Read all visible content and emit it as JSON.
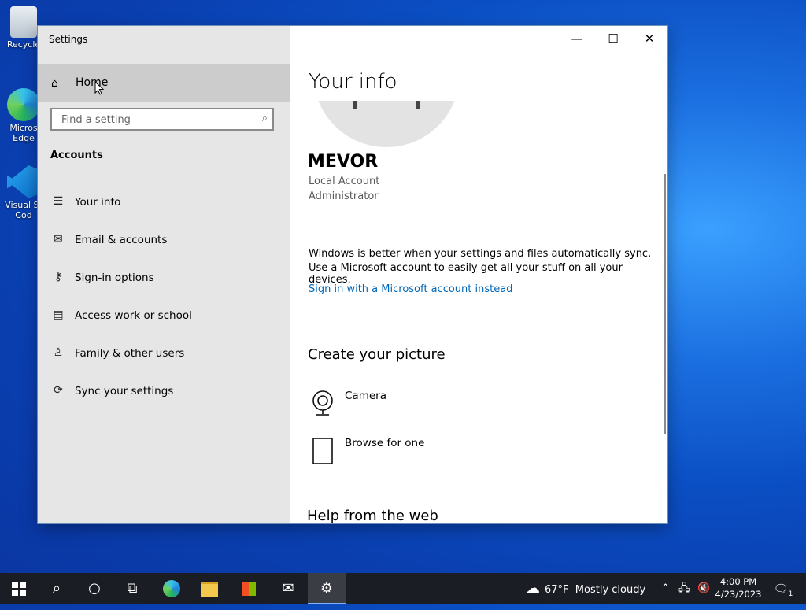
{
  "desktop": {
    "icons": [
      {
        "label": "Recycle"
      },
      {
        "label": "Micros Edge"
      },
      {
        "label": "Visual St Cod"
      }
    ]
  },
  "window": {
    "title": "Settings",
    "controls": {
      "minimize": "—",
      "maximize": "☐",
      "close": "✕"
    }
  },
  "sidebar": {
    "home_label": "Home",
    "search_placeholder": "Find a setting",
    "section_label": "Accounts",
    "items": [
      {
        "label": "Your info",
        "icon": "person-list-icon"
      },
      {
        "label": "Email & accounts",
        "icon": "mail-icon"
      },
      {
        "label": "Sign-in options",
        "icon": "key-icon"
      },
      {
        "label": "Access work or school",
        "icon": "briefcase-icon"
      },
      {
        "label": "Family & other users",
        "icon": "add-person-icon"
      },
      {
        "label": "Sync your settings",
        "icon": "sync-icon"
      }
    ]
  },
  "main": {
    "title": "Your info",
    "user_name": "MEVOR",
    "account_type": "Local Account",
    "account_role": "Administrator",
    "sync_line1": "Windows is better when your settings and files automatically sync.",
    "sync_line2": "Use a Microsoft account to easily get all your stuff on all your devices.",
    "ms_link": "Sign in with a Microsoft account instead",
    "create_title": "Create your picture",
    "camera_label": "Camera",
    "browse_label": "Browse for one",
    "help_title": "Help from the web"
  },
  "taskbar": {
    "weather_temp": "67°F",
    "weather_text": "Mostly cloudy",
    "time": "4:00 PM",
    "date": "4/23/2023",
    "notification_count": "1"
  }
}
